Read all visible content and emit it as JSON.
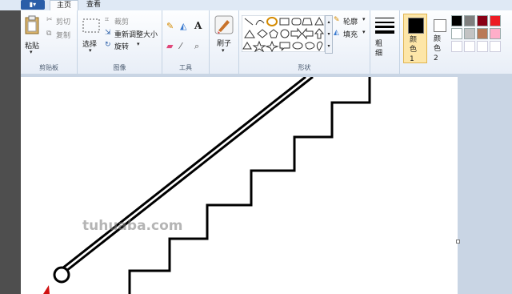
{
  "tabs": {
    "home": "主页",
    "view": "查看"
  },
  "clipboard": {
    "paste": "粘贴",
    "cut": "剪切",
    "copy": "复制",
    "label": "剪贴板"
  },
  "image": {
    "select": "选择",
    "crop": "裁剪",
    "resize": "重新调整大小",
    "rotate": "旋转",
    "label": "图像"
  },
  "tools": {
    "label": "工具",
    "text_tool": "A"
  },
  "brushes": {
    "label": "刷子"
  },
  "shapes": {
    "outline": "轮廓",
    "fill": "填充",
    "label": "形状"
  },
  "size": {
    "label": "粗细"
  },
  "colors": {
    "color1": "颜色 1",
    "color2": "颜色 2",
    "color1_value": "#000000",
    "color2_value": "#ffffff",
    "palette_row1": [
      "#000000",
      "#7f7f7f",
      "#880015",
      "#ed1c24"
    ],
    "palette_row2": [
      "#ffffff",
      "#c3c3c3",
      "#b97a57",
      "#ffaec9"
    ]
  },
  "watermark": "tuhuaba.com"
}
